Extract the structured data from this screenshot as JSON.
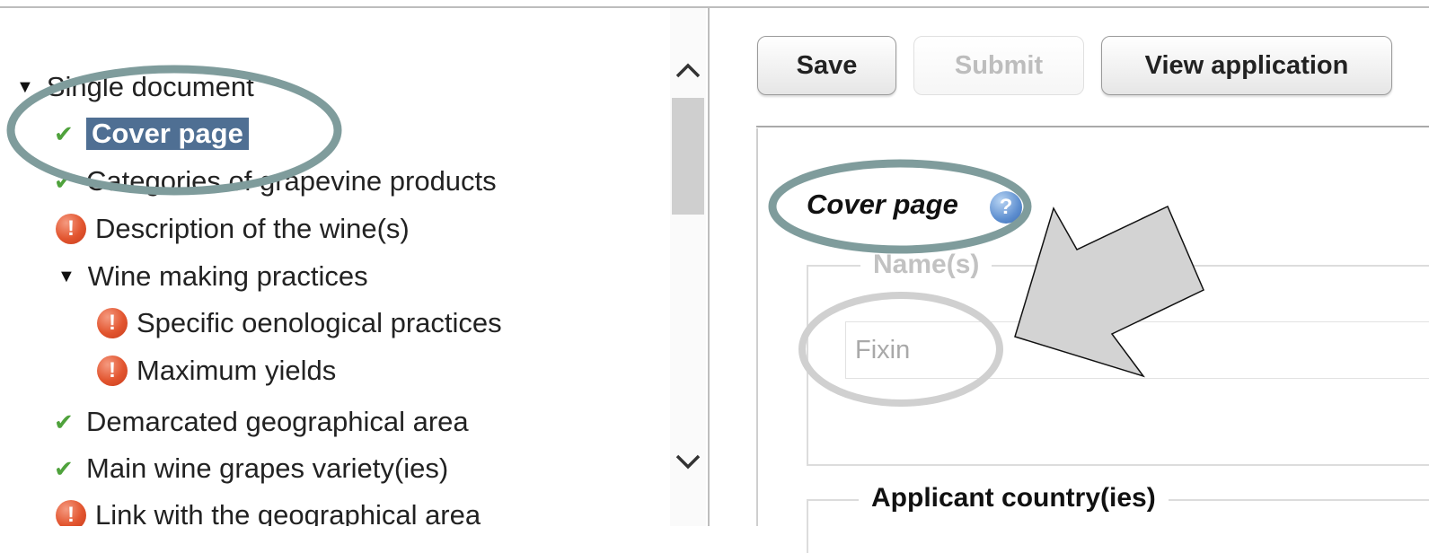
{
  "tree": {
    "root_label": "Single document",
    "items": [
      {
        "label": "Cover page",
        "status": "ok",
        "selected": true
      },
      {
        "label": "Categories of grapevine products",
        "status": "ok"
      },
      {
        "label": "Description of the wine(s)",
        "status": "error"
      },
      {
        "label": "Wine making practices",
        "status": "group"
      },
      {
        "label": "Specific oenological practices",
        "status": "error"
      },
      {
        "label": "Maximum yields",
        "status": "error"
      },
      {
        "label": "Demarcated geographical area",
        "status": "ok"
      },
      {
        "label": "Main wine grapes variety(ies)",
        "status": "ok"
      },
      {
        "label": "Link with the geographical area",
        "status": "error"
      }
    ]
  },
  "toolbar": {
    "save_label": "Save",
    "submit_label": "Submit",
    "view_label": "View application"
  },
  "form": {
    "section_title": "Cover page",
    "names_legend": "Name(s)",
    "name_value": "Fixin",
    "country_legend": "Applicant country(ies)"
  },
  "colors": {
    "selection": "#4f6f93",
    "ok_check": "#4fa23c",
    "error_icon": "#e2552f",
    "annotation_ellipse": "#7f9c9c"
  },
  "icons": {
    "expand": "triangle-down-icon",
    "ok": "check-icon",
    "error": "exclamation-icon",
    "help": "help-icon"
  }
}
